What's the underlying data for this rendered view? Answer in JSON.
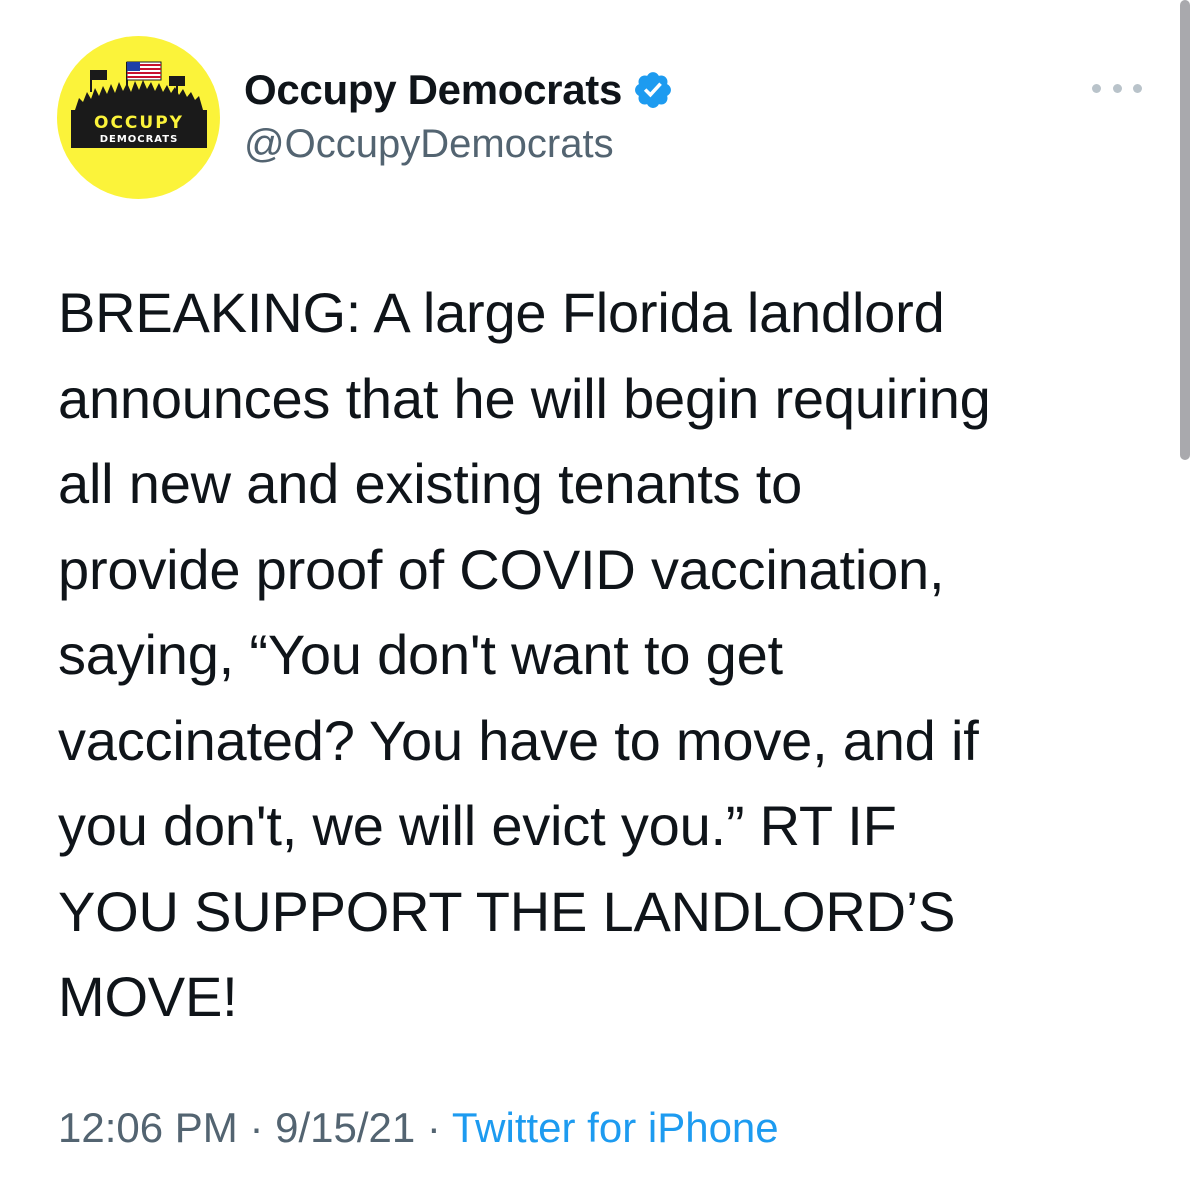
{
  "account": {
    "display_name": "Occupy Democrats",
    "handle": "@OccupyDemocrats",
    "verified": true,
    "avatar": {
      "icon": "occupy-democrats-logo",
      "text_line1": "OCCUPY",
      "text_line2": "DEMOCRATS",
      "background_color": "#fbf33a"
    }
  },
  "tweet": {
    "text": "BREAKING: A large Florida landlord\nannounces that he will begin requiring\nall new and existing tenants to\nprovide proof of COVID vaccination,\nsaying, “You don't want to get\nvaccinated? You have to move, and if\nyou don't, we will evict you.” RT IF\nYOU SUPPORT THE LANDLORD’S\nMOVE!"
  },
  "meta": {
    "time": "12:06 PM",
    "date": "9/15/21",
    "separator": " · ",
    "source": "Twitter for iPhone"
  },
  "icons": {
    "verified": "verified-badge-icon",
    "more": "more-options-icon"
  },
  "colors": {
    "link": "#1d9bf0",
    "secondary_text": "#536471",
    "primary_text": "#0f1419"
  }
}
